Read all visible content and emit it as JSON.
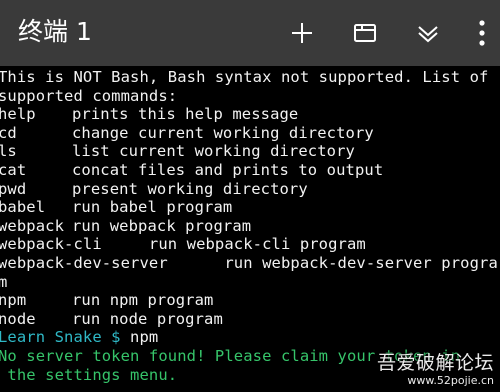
{
  "titlebar": {
    "title": "终端 1",
    "icons": [
      "plus-icon",
      "window-icon",
      "double-chevron-down-icon",
      "more-vertical-icon"
    ]
  },
  "terminal": {
    "intro": [
      "This is NOT Bash, Bash syntax not supported. List of",
      "supported commands:"
    ],
    "commands": [
      {
        "name": "help",
        "desc": "prints this help message"
      },
      {
        "name": "cd",
        "desc": "change current working directory"
      },
      {
        "name": "ls",
        "desc": "list current working directory"
      },
      {
        "name": "cat",
        "desc": "concat files and prints to output"
      },
      {
        "name": "pwd",
        "desc": "present working directory"
      },
      {
        "name": "babel",
        "desc": "run babel program"
      },
      {
        "name": "webpack",
        "desc": "run webpack program"
      }
    ],
    "extra_lines": [
      "webpack-cli     run webpack-cli program",
      "webpack-dev-server      run webpack-dev-server progra",
      "m"
    ],
    "commands2": [
      {
        "name": "npm",
        "desc": "run npm program"
      },
      {
        "name": "node",
        "desc": "run node program"
      }
    ],
    "prompt": "Learn Snake $",
    "prompt_command": " npm",
    "error_lines": [
      "No server token found! Please claim your token in",
      " the settings menu."
    ]
  },
  "watermark": {
    "site_name": "吾爱破解论坛",
    "url": "www.52pojie.cn"
  },
  "colors": {
    "titlebar_bg": "#3a3a3a",
    "terminal_bg": "#000000",
    "text": "#f2f2f2",
    "prompt": "#2fb8c6",
    "error": "#36c46a"
  }
}
